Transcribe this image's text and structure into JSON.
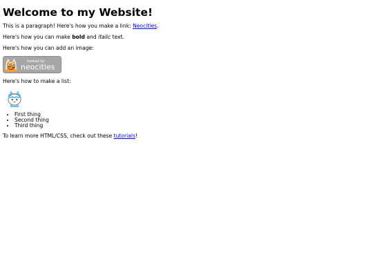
{
  "page": {
    "heading": "Welcome to my Website!",
    "intro_text": "This is a paragraph! Here's how you make a link: ",
    "link_text": "Neocities",
    "intro_end": ".",
    "format_text_1": "Here's how you can make ",
    "bold_text": "bold",
    "format_text_2": " and ",
    "italic_text": "italic",
    "format_text_3": " text.",
    "image_text": "Here's how you can add an image:",
    "badge": {
      "small_label": "hosted by",
      "brand_label": "neocities",
      "bg_color": "#a6a6a6"
    },
    "list_text": "Here's how to make a list:",
    "list_items": [
      "First thing",
      "Second thing",
      "Third thing"
    ],
    "learn_text_1": "To learn more HTML/CSS, check out these ",
    "tutorials_link": "tutorials",
    "learn_text_2": "!"
  },
  "colors": {
    "link": "#0000ee",
    "text": "#000000",
    "background": "#ffffff",
    "cat_orange": "#f29b3a",
    "kitty_blue": "#66c4e6"
  },
  "icons": {
    "badge_mascot": "neocities-cat-icon",
    "list_mascot": "blue-kitty-icon"
  }
}
